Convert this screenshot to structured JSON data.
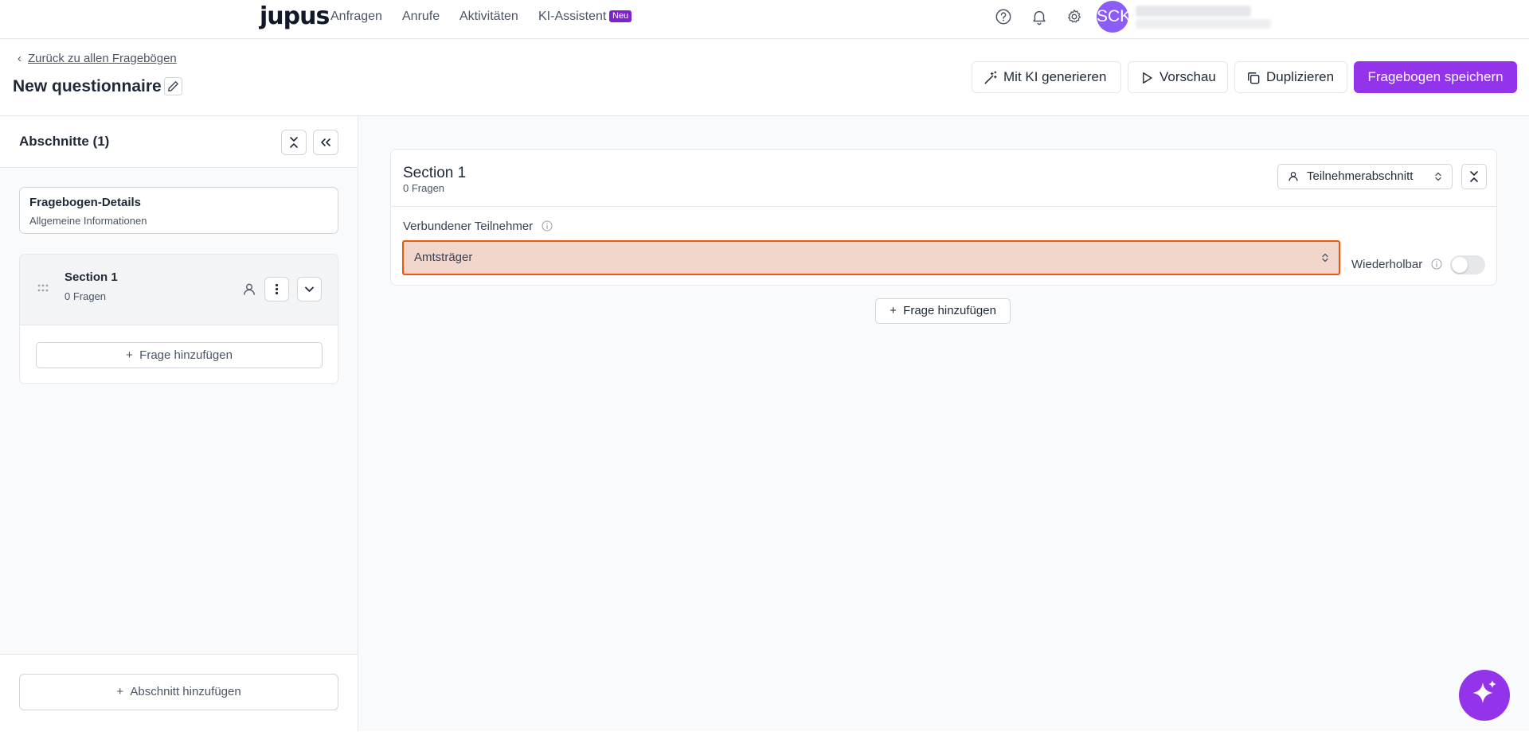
{
  "nav": {
    "logo": "jupus",
    "links": [
      "Anfragen",
      "Anrufe",
      "Aktivitäten",
      "KI-Assistent"
    ],
    "new_badge": "Neu",
    "avatar_initials": "SCK"
  },
  "header": {
    "back_label": "Zurück zu allen Fragebögen",
    "title": "New questionnaire",
    "buttons": {
      "generate": "Mit KI generieren",
      "preview": "Vorschau",
      "duplicate": "Duplizieren",
      "save": "Fragebogen speichern"
    }
  },
  "sidebar": {
    "title": "Abschnitte (1)",
    "details": {
      "title": "Fragebogen-Details",
      "subtitle": "Allgemeine Informationen"
    },
    "sections": [
      {
        "name": "Section 1",
        "count": "0 Fragen"
      }
    ],
    "add_question": "Frage hinzufügen",
    "add_section": "Abschnitt hinzufügen"
  },
  "main": {
    "section": {
      "title": "Section 1",
      "count": "0 Fragen",
      "type_label": "Teilnehmerabschnitt",
      "connected_label": "Verbundener Teilnehmer",
      "connected_value": "Amtsträger",
      "repeatable_label": "Wiederholbar",
      "repeatable_on": false
    },
    "add_question": "Frage hinzufügen"
  },
  "colors": {
    "accent": "#9333ea",
    "error_border": "#ea580c",
    "error_fill": "#f2d6cc"
  }
}
